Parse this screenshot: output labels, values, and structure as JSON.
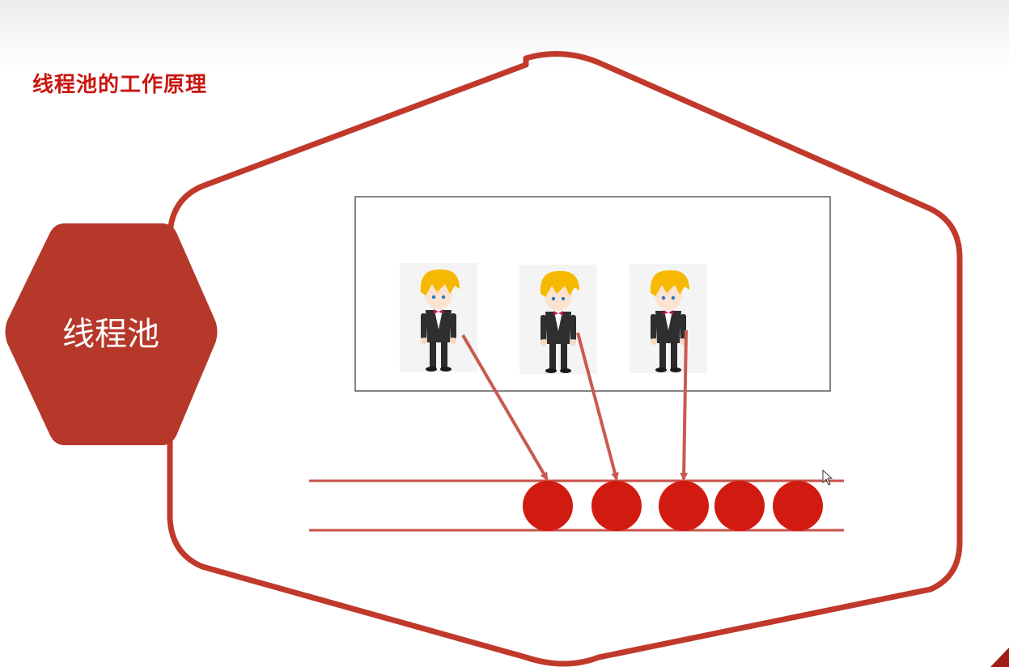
{
  "slide": {
    "title": "线程池的工作原理"
  },
  "badge": {
    "label": "线程池"
  },
  "pool": {
    "thread_count": 3,
    "icon": "waiter-character-icon"
  },
  "queue": {
    "task_count": 5
  },
  "colors": {
    "title": "#c8160f",
    "hexagon_outline": "#c0392b",
    "badge_fill": "#b5382a",
    "task_ball": "#d11a10",
    "arrow": "#c95a4e",
    "hair": "#f6b800"
  }
}
